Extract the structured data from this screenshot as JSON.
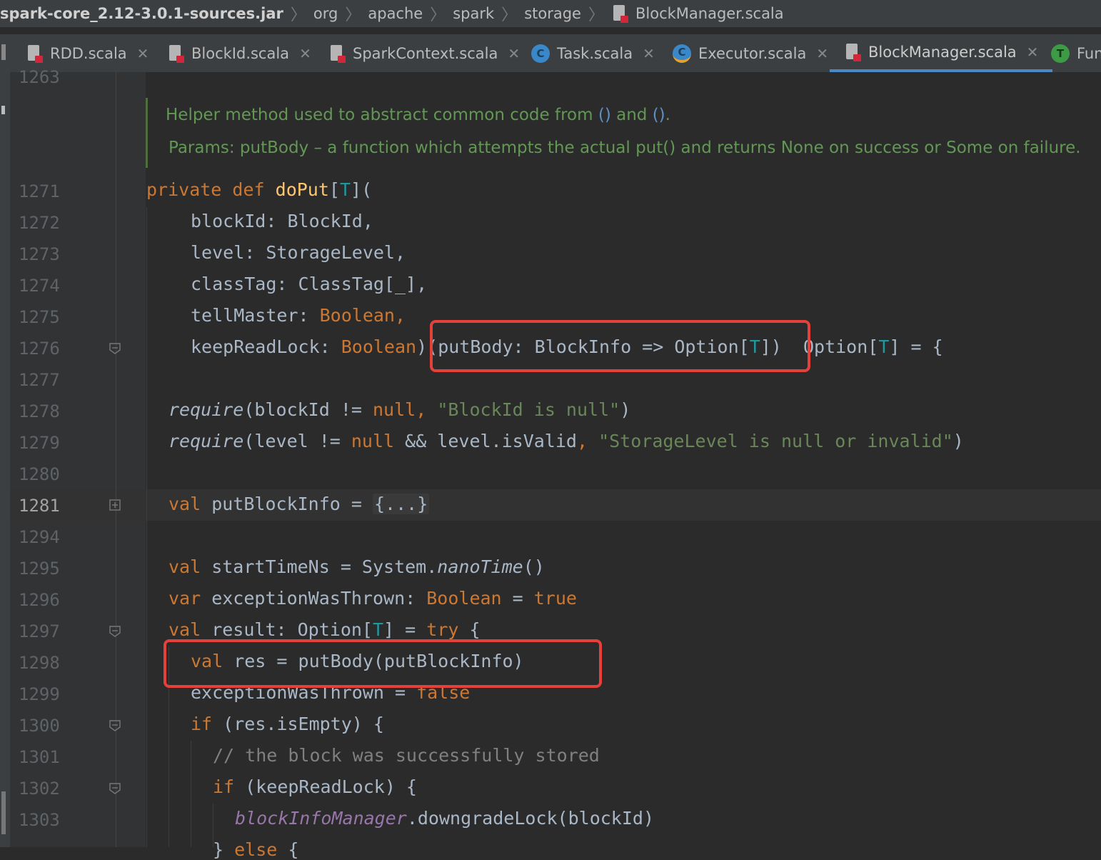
{
  "breadcrumb": {
    "items": [
      "spark-core_2.12-3.0.1-sources.jar",
      "org",
      "apache",
      "spark",
      "storage",
      "BlockManager.scala"
    ]
  },
  "tabs": [
    {
      "label": "RDD.scala",
      "icon": "scala-file-icon"
    },
    {
      "label": "BlockId.scala",
      "icon": "scala-file-icon"
    },
    {
      "label": "SparkContext.scala",
      "icon": "scala-file-icon"
    },
    {
      "label": "Task.scala",
      "icon": "scala-class-icon"
    },
    {
      "label": "Executor.scala",
      "icon": "scala-class-icon"
    },
    {
      "label": "BlockManager.scala",
      "icon": "scala-file-icon",
      "active": true
    },
    {
      "label": "Fun",
      "icon": "trait-icon"
    }
  ],
  "doc": {
    "line1": "Helper method used to abstract common code from",
    "line1_and": "and",
    "line2": "Params: putBody – a function which attempts the actual put() and returns None on success or Some on failure.",
    "paren": "()"
  },
  "gutter": {
    "top_partial": "1263",
    "current_line": "1281",
    "lines": [
      "1271",
      "1272",
      "1273",
      "1274",
      "1275",
      "1276",
      "1277",
      "1278",
      "1279",
      "1280",
      "1281",
      "1294",
      "1295",
      "1296",
      "1297",
      "1298",
      "1299",
      "1300",
      "1301",
      "1302",
      "1303"
    ]
  },
  "code": {
    "l1271": {
      "k1": "private",
      "k2": "def",
      "fn": "doPut",
      "b1": "[",
      "t": "T",
      "b2": "]("
    },
    "l1272": "blockId: BlockId,",
    "l1273": "level: StorageLevel,",
    "l1274": "classTag: ClassTag[_],",
    "l1275": {
      "a": "tellMaster: ",
      "b": "Boolean",
      "c": ","
    },
    "l1276": {
      "a": "keepReadLock: ",
      "b": "Boolean",
      "c": ")",
      "d": "(putBody: BlockInfo => Option[",
      "t": "T",
      "e": "])",
      "f": " Option[",
      "t2": "T",
      "g": "] = {"
    },
    "l1278": {
      "req": "require",
      "a": "(blockId != ",
      "null": "null",
      "c": ", ",
      "s": "\"BlockId is null\"",
      "e": ")"
    },
    "l1279": {
      "req": "require",
      "a": "(level != ",
      "null": "null",
      "c": " && level.isValid",
      "d": ", ",
      "s": "\"StorageLevel is null or invalid\"",
      "e": ")"
    },
    "l1281": {
      "k": "val",
      "a": " putBlockInfo = ",
      "f": "{...}"
    },
    "l1295": {
      "k": "val",
      "a": " startTimeNs = System.",
      "m": "nanoTime",
      "e": "()"
    },
    "l1296": {
      "k": "var",
      "a": " exceptionWasThrown: ",
      "b": "Boolean",
      "c": " = ",
      "v": "true"
    },
    "l1297": {
      "k": "val",
      "a": " result: Option[",
      "t": "T",
      "c": "] = ",
      "kt": "try",
      "e": " {"
    },
    "l1298": {
      "k": "val",
      "a": " res = putBody(putBlockInfo)"
    },
    "l1299": {
      "a": "exceptionWasThrown = ",
      "v": "false"
    },
    "l1300": {
      "k": "if",
      "a": " (res.isEmpty) {"
    },
    "l1301": "// the block was successfully stored",
    "l1302": {
      "k": "if",
      "a": " (keepReadLock) {"
    },
    "l1303": {
      "p": "blockInfoManager",
      "a": ".downgradeLock(blockId)"
    },
    "l1304": {
      "a": "} ",
      "k": "else",
      "b": " {"
    }
  },
  "colors": {
    "highlight": "#e5403a",
    "keyword": "#cc7832",
    "function": "#ffc66d",
    "string": "#6a8759",
    "doc": "#629755"
  }
}
